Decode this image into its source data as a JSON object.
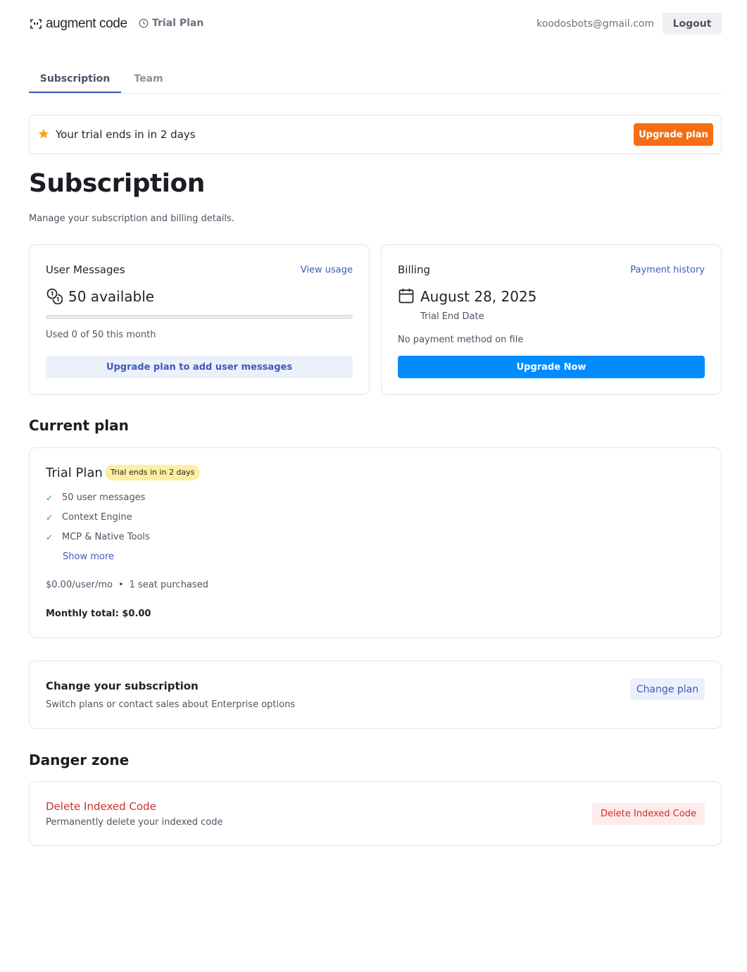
{
  "header": {
    "logo_text": "augment code",
    "plan_chip": "Trial Plan",
    "user_email": "koodosbots@gmail.com",
    "logout_label": "Logout"
  },
  "tabs": [
    {
      "label": "Subscription",
      "active": true
    },
    {
      "label": "Team",
      "active": false
    }
  ],
  "banner": {
    "text": "Your trial ends in in 2 days",
    "button_label": "Upgrade plan",
    "icon": "star-icon",
    "accent_color": "#f56e14"
  },
  "page": {
    "title": "Subscription",
    "subtitle": "Manage your subscription and billing details."
  },
  "messages_card": {
    "title": "User Messages",
    "link": "View usage",
    "value": "50 available",
    "used_text": "Used 0 of 50 this month",
    "usage_fraction": 0,
    "button_label": "Upgrade plan to add user messages",
    "icon": "coins-icon"
  },
  "billing_card": {
    "title": "Billing",
    "link": "Payment history",
    "date": "August 28, 2025",
    "date_label": "Trial End Date",
    "payment_status": "No payment method on file",
    "button_label": "Upgrade Now",
    "button_color": "#008cff",
    "icon": "calendar-icon"
  },
  "current_plan": {
    "heading": "Current plan",
    "name": "Trial Plan",
    "badge": "Trial ends in in 2 days",
    "features": [
      "50 user messages",
      "Context Engine",
      "MCP & Native Tools"
    ],
    "show_more": "Show more",
    "price": "$0.00/user/mo",
    "seats": "1 seat purchased",
    "monthly_total": "Monthly total: $0.00"
  },
  "change_subscription": {
    "title": "Change your subscription",
    "description": "Switch plans or contact sales about Enterprise options",
    "button_label": "Change plan"
  },
  "danger_zone": {
    "heading": "Danger zone",
    "title": "Delete Indexed Code",
    "description": "Permanently delete your indexed code",
    "button_label": "Delete Indexed Code",
    "danger_color": "#cf2e2e"
  }
}
